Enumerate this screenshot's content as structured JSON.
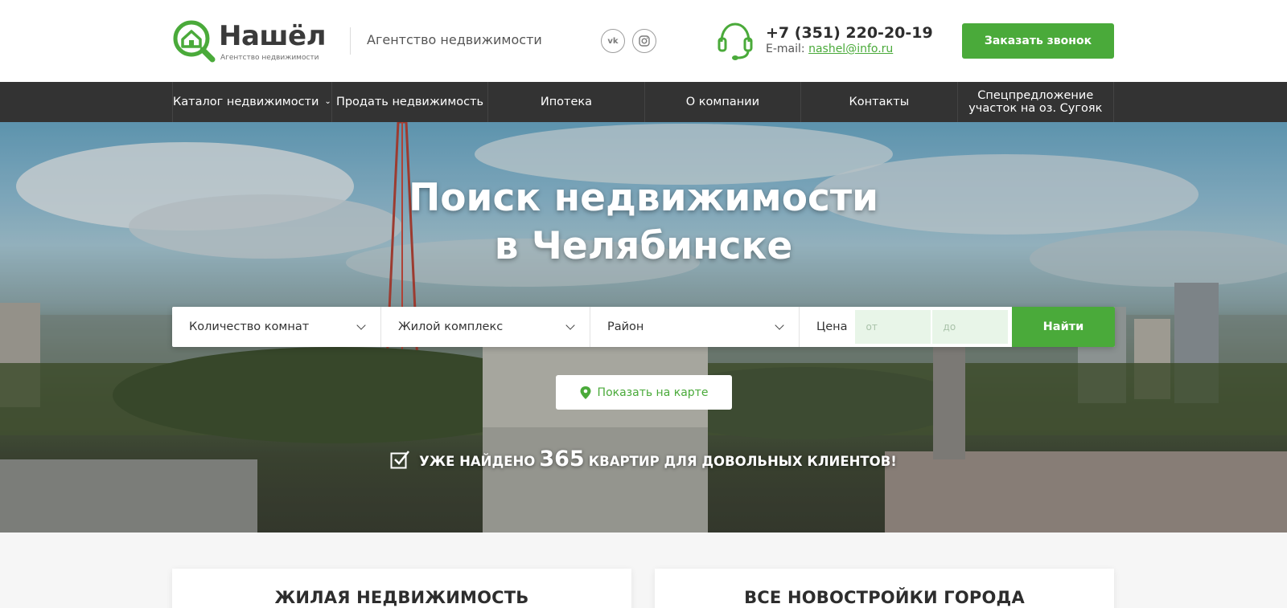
{
  "header": {
    "logo_name": "Нашёл",
    "logo_subtitle": "Агентство недвижимости",
    "tagline": "Агентство недвижимости",
    "social": [
      {
        "icon": "vk-icon",
        "label": "vk"
      },
      {
        "icon": "instagram-icon",
        "label": ""
      }
    ],
    "phone": "+7 (351) 220-20-19",
    "email_label": "E-mail:",
    "email": "nashel@info.ru",
    "callback_label": "Заказать звонок"
  },
  "nav": {
    "items": [
      {
        "label": "Каталог недвижимости",
        "has_dropdown": true
      },
      {
        "label": "Продать недвижимость"
      },
      {
        "label": "Ипотека"
      },
      {
        "label": "О компании"
      },
      {
        "label": "Контакты"
      },
      {
        "label_line1": "Спецпредложение",
        "label_line2": "участок на оз. Сугояк"
      }
    ]
  },
  "hero": {
    "title_line1": "Поиск недвижимости",
    "title_line2": "в Челябинске",
    "search": {
      "rooms": "Количество комнат",
      "complex": "Жилой комплекс",
      "district": "Район",
      "price_label": "Цена",
      "price_from_placeholder": "от",
      "price_to_placeholder": "до",
      "find_label": "Найти"
    },
    "map_button_label": "Показать на карте",
    "stat_prefix": "УЖЕ НАЙДЕНО",
    "stat_number": "365",
    "stat_suffix": "КВАРТИР ДЛЯ ДОВОЛЬНЫХ КЛИЕНТОВ!"
  },
  "cards": [
    {
      "title": "ЖИЛАЯ НЕДВИЖИМОСТЬ"
    },
    {
      "title": "ВСЕ НОВОСТРОЙКИ ГОРОДА"
    }
  ],
  "colors": {
    "accent": "#4aaa3a",
    "nav_bg": "#333333",
    "text": "#2d2d2d"
  }
}
